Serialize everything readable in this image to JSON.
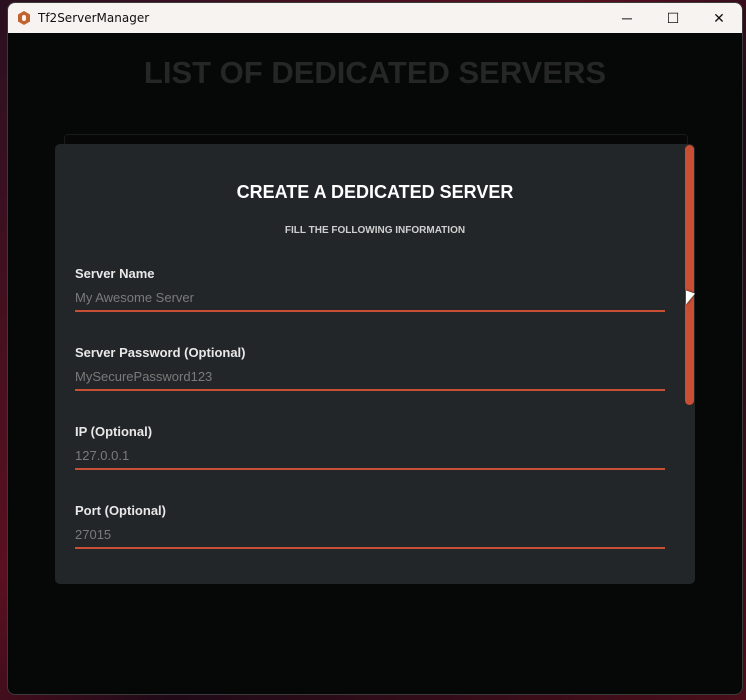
{
  "window": {
    "title": "Tf2ServerManager",
    "controls": {
      "minimize": "─",
      "maximize": "☐",
      "close": "✕"
    }
  },
  "page": {
    "heading": "LIST OF DEDICATED SERVERS"
  },
  "modal": {
    "title": "CREATE A DEDICATED SERVER",
    "subtitle": "FILL THE FOLLOWING INFORMATION",
    "fields": [
      {
        "label": "Server Name",
        "placeholder": "My Awesome Server"
      },
      {
        "label": "Server Password (Optional)",
        "placeholder": "MySecurePassword123"
      },
      {
        "label": "IP (Optional)",
        "placeholder": "127.0.0.1"
      },
      {
        "label": "Port (Optional)",
        "placeholder": "27015"
      }
    ]
  },
  "colors": {
    "accent": "#c84f34",
    "modal_bg": "#232628",
    "app_bg": "#060707"
  }
}
